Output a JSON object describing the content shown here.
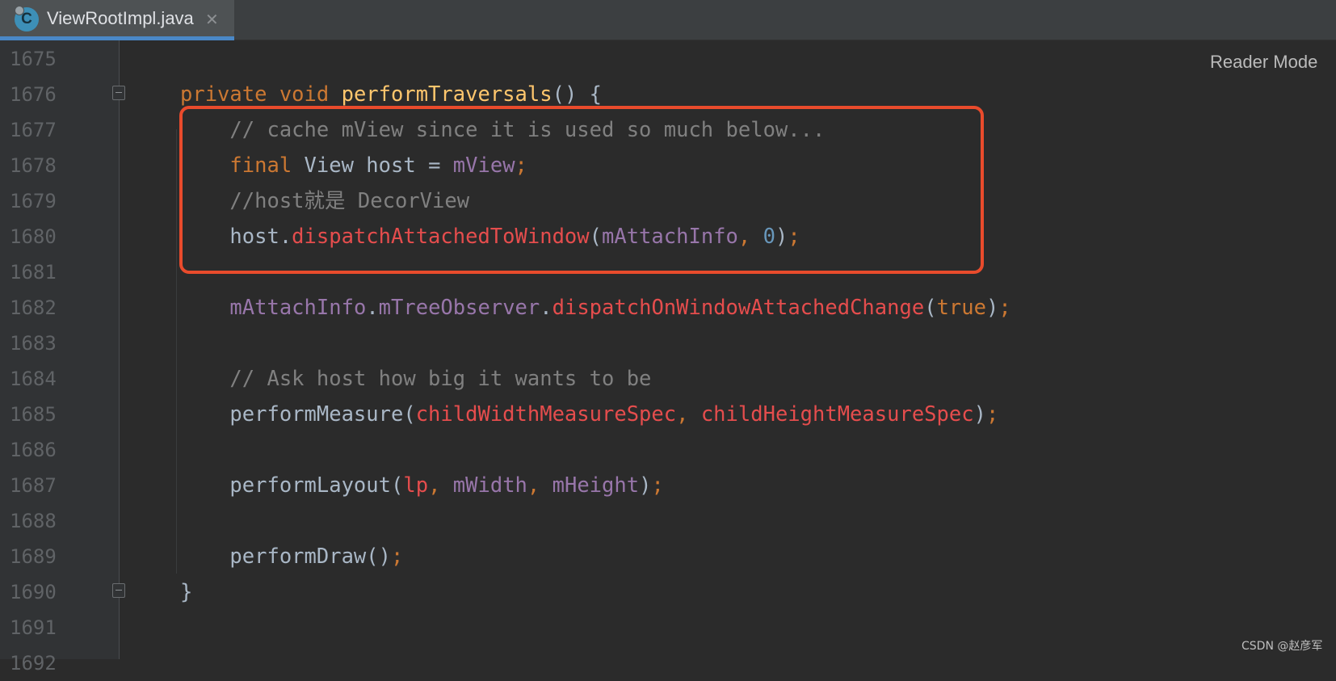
{
  "tab": {
    "label": "ViewRootImpl.java",
    "icon_letter": "C",
    "icon": "java-class-icon",
    "close_glyph": "✕"
  },
  "reader_mode_label": "Reader Mode",
  "watermark": "CSDN @赵彦军",
  "colors": {
    "background": "#2b2b2b",
    "keyword": "#cc7832",
    "method_decl": "#ffc66d",
    "comment": "#808080",
    "field": "#9876aa",
    "call": "#e54d4d",
    "number": "#6897bb",
    "highlight_border": "#e94b2c"
  },
  "lines": [
    {
      "number": "1675",
      "tokens": []
    },
    {
      "number": "1676",
      "fold": true,
      "tokens": [
        [
          "kw",
          "private "
        ],
        [
          "kw",
          "void "
        ],
        [
          "fn",
          "performTraversals"
        ],
        [
          "pl",
          "() {"
        ]
      ]
    },
    {
      "number": "1677",
      "tokens": [
        [
          "pl",
          "    "
        ],
        [
          "cm",
          "// cache mView since it is used so much below..."
        ]
      ]
    },
    {
      "number": "1678",
      "tokens": [
        [
          "pl",
          "    "
        ],
        [
          "kw",
          "final "
        ],
        [
          "pl",
          "View host = "
        ],
        [
          "fld",
          "mView"
        ],
        [
          "pn",
          ";"
        ]
      ]
    },
    {
      "number": "1679",
      "tokens": [
        [
          "pl",
          "    "
        ],
        [
          "cm",
          "//host就是 DecorView"
        ]
      ]
    },
    {
      "number": "1680",
      "tokens": [
        [
          "pl",
          "    host."
        ],
        [
          "call",
          "dispatchAttachedToWindow"
        ],
        [
          "pl",
          "("
        ],
        [
          "fld",
          "mAttachInfo"
        ],
        [
          "pn",
          ", "
        ],
        [
          "num",
          "0"
        ],
        [
          "pl",
          ")"
        ],
        [
          "pn",
          ";"
        ]
      ]
    },
    {
      "number": "1681",
      "tokens": []
    },
    {
      "number": "1682",
      "tokens": [
        [
          "pl",
          "    "
        ],
        [
          "fld",
          "mAttachInfo"
        ],
        [
          "pl",
          "."
        ],
        [
          "fld",
          "mTreeObserver"
        ],
        [
          "pl",
          "."
        ],
        [
          "call",
          "dispatchOnWindowAttachedChange"
        ],
        [
          "pl",
          "("
        ],
        [
          "kw",
          "true"
        ],
        [
          "pl",
          ")"
        ],
        [
          "pn",
          ";"
        ]
      ]
    },
    {
      "number": "1683",
      "tokens": []
    },
    {
      "number": "1684",
      "tokens": [
        [
          "pl",
          "    "
        ],
        [
          "cm",
          "// Ask host how big it wants to be"
        ]
      ]
    },
    {
      "number": "1685",
      "tokens": [
        [
          "pl",
          "    performMeasure("
        ],
        [
          "call",
          "childWidthMeasureSpec"
        ],
        [
          "pn",
          ", "
        ],
        [
          "call",
          "childHeightMeasureSpec"
        ],
        [
          "pl",
          ")"
        ],
        [
          "pn",
          ";"
        ]
      ]
    },
    {
      "number": "1686",
      "tokens": []
    },
    {
      "number": "1687",
      "tokens": [
        [
          "pl",
          "    performLayout("
        ],
        [
          "call",
          "lp"
        ],
        [
          "pn",
          ", "
        ],
        [
          "fld",
          "mWidth"
        ],
        [
          "pn",
          ", "
        ],
        [
          "fld",
          "mHeight"
        ],
        [
          "pl",
          ")"
        ],
        [
          "pn",
          ";"
        ]
      ]
    },
    {
      "number": "1688",
      "tokens": []
    },
    {
      "number": "1689",
      "tokens": [
        [
          "pl",
          "    performDraw()"
        ],
        [
          "pn",
          ";"
        ]
      ]
    },
    {
      "number": "1690",
      "fold": true,
      "tokens": [
        [
          "pl",
          "}"
        ]
      ]
    },
    {
      "number": "1691",
      "tokens": []
    },
    {
      "number": "1692",
      "tokens": []
    }
  ]
}
